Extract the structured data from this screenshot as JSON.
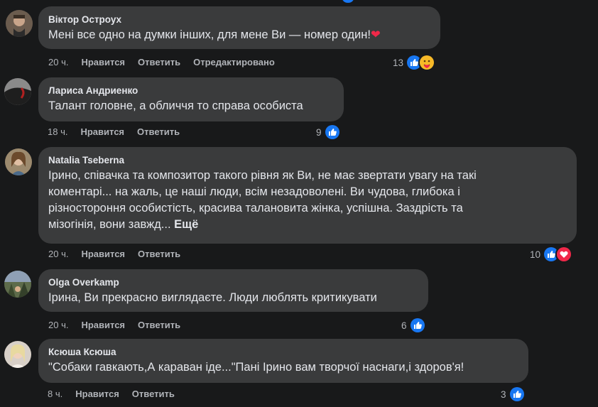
{
  "comments": [
    {
      "author": "Віктор Остроух",
      "text": "Мені все одно на думки інших, для мене Ви — номер один!",
      "emoji": "❤",
      "time": "20 ч.",
      "like": "Нравится",
      "reply": "Ответить",
      "edited": "Отредактировано",
      "reactions_count": "13",
      "reactions": [
        "like-icon",
        "care-icon"
      ]
    },
    {
      "author": "Лариса Андриенко",
      "text": "Талант головне, а обличчя то справа особиста",
      "time": "18 ч.",
      "like": "Нравится",
      "reply": "Ответить",
      "reactions_count": "9",
      "reactions": [
        "like-icon"
      ]
    },
    {
      "author": "Natalia Tseberna",
      "text_lines": [
        "Ірино, співачка та композитор такого рівня як Ви, не має звертати увагу на такі",
        "коментарі... на жаль, це наші люди, всім незадоволені. Ви чудова, глибока і",
        "різностороння особистість, красива талановита жінка, успішна. Заздрість та",
        "мізогінія, вони завжд..."
      ],
      "more": "Ещё",
      "time": "20 ч.",
      "like": "Нравится",
      "reply": "Ответить",
      "reactions_count": "10",
      "reactions": [
        "like-icon",
        "love-icon"
      ]
    },
    {
      "author": "Olga Overkamp",
      "text": "Ірина, Ви прекрасно виглядаєте. Люди люблять критикувати",
      "time": "20 ч.",
      "like": "Нравится",
      "reply": "Ответить",
      "reactions_count": "6",
      "reactions": [
        "like-icon"
      ]
    },
    {
      "author": "Ксюша Ксюша",
      "text": "\"Собаки гавкають,А караван іде...\"Пані Ірино вам творчої наснаги,і здоров'я!",
      "time": "8 ч.",
      "like": "Нравится",
      "reply": "Ответить",
      "reactions_count": "3",
      "reactions": [
        "like-icon"
      ]
    }
  ],
  "colors": {
    "background": "#18191a",
    "bubble": "#3a3b3c",
    "like_blue": "#1877f2",
    "love_red": "#f02849",
    "muted": "#b0b3b8"
  }
}
